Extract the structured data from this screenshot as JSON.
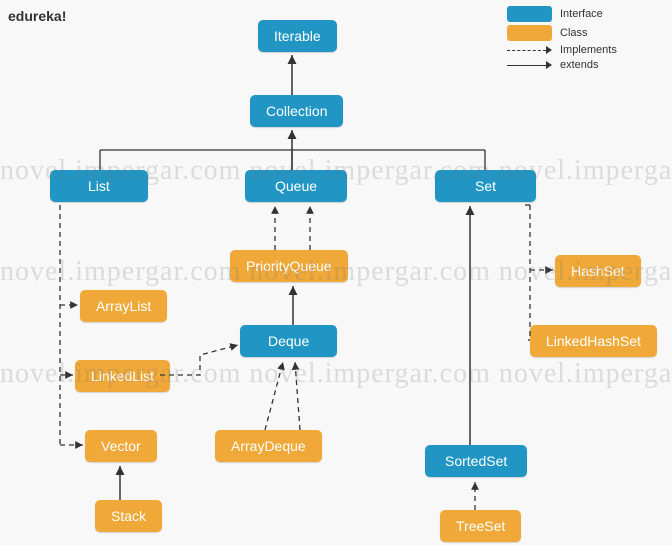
{
  "brand": "edureka!",
  "legend": {
    "interface": "Interface",
    "class": "Class",
    "implements": "Implements",
    "extends": "extends"
  },
  "colors": {
    "interface": "#2196c4",
    "class": "#f0a938"
  },
  "watermark": "novel.impergar.com",
  "nodes": {
    "iterable": {
      "label": "Iterable",
      "type": "interface"
    },
    "collection": {
      "label": "Collection",
      "type": "interface"
    },
    "list": {
      "label": "List",
      "type": "interface"
    },
    "queue": {
      "label": "Queue",
      "type": "interface"
    },
    "set": {
      "label": "Set",
      "type": "interface"
    },
    "priorityqueue": {
      "label": "PriorityQueue",
      "type": "class"
    },
    "arraylist": {
      "label": "ArrayList",
      "type": "class"
    },
    "linkedlist": {
      "label": "LinkedList",
      "type": "class"
    },
    "vector": {
      "label": "Vector",
      "type": "class"
    },
    "stack": {
      "label": "Stack",
      "type": "class"
    },
    "deque": {
      "label": "Deque",
      "type": "interface"
    },
    "arraydeque": {
      "label": "ArrayDeque",
      "type": "class"
    },
    "sortedset": {
      "label": "SortedSet",
      "type": "interface"
    },
    "treeset": {
      "label": "TreeSet",
      "type": "class"
    },
    "hashset": {
      "label": "HashSet",
      "type": "class"
    },
    "linkedhashset": {
      "label": "LinkedHashSet",
      "type": "class"
    }
  },
  "edges": [
    {
      "from": "collection",
      "to": "iterable",
      "kind": "extends"
    },
    {
      "from": "list",
      "to": "collection",
      "kind": "extends"
    },
    {
      "from": "queue",
      "to": "collection",
      "kind": "extends"
    },
    {
      "from": "set",
      "to": "collection",
      "kind": "extends"
    },
    {
      "from": "arraylist",
      "to": "list",
      "kind": "implements"
    },
    {
      "from": "linkedlist",
      "to": "list",
      "kind": "implements"
    },
    {
      "from": "vector",
      "to": "list",
      "kind": "implements"
    },
    {
      "from": "stack",
      "to": "vector",
      "kind": "extends"
    },
    {
      "from": "priorityqueue",
      "to": "queue",
      "kind": "implements"
    },
    {
      "from": "deque",
      "to": "queue",
      "kind": "extends"
    },
    {
      "from": "linkedlist",
      "to": "deque",
      "kind": "implements"
    },
    {
      "from": "arraydeque",
      "to": "deque",
      "kind": "implements"
    },
    {
      "from": "sortedset",
      "to": "set",
      "kind": "extends"
    },
    {
      "from": "treeset",
      "to": "sortedset",
      "kind": "implements"
    },
    {
      "from": "hashset",
      "to": "set",
      "kind": "implements"
    },
    {
      "from": "linkedhashset",
      "to": "set",
      "kind": "implements"
    }
  ]
}
